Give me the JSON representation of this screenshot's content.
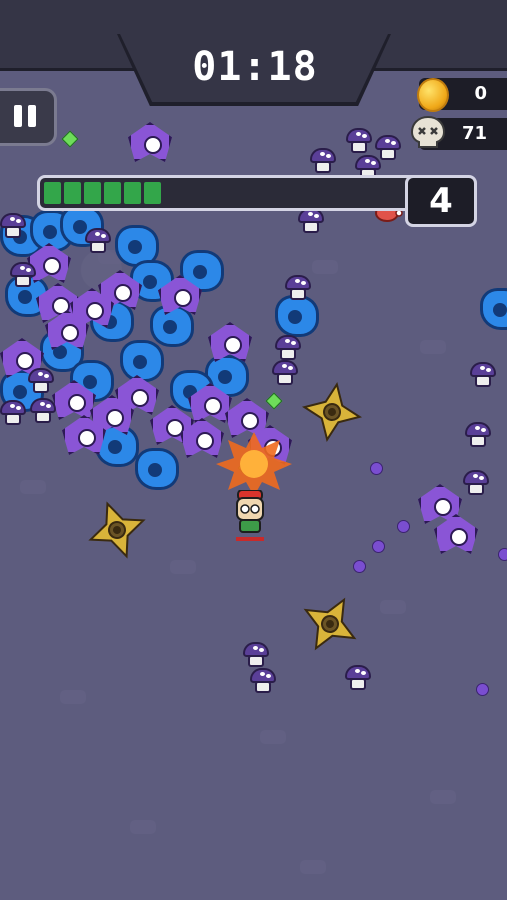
{
  "hud": {
    "timer": "01:18",
    "coins": "0",
    "kills": "71",
    "level": "4",
    "xp_progress": 0.27,
    "xp_segments": 6
  },
  "icons": {
    "pause": "pause-icon",
    "coin": "coin-icon",
    "kills": "skull-icon",
    "pickup": "meat-icon"
  },
  "colors": {
    "background": "#5d5c7e",
    "xp_fill": "#33a64a",
    "enemy_blob": "#2c88e8",
    "enemy_eye": "#8a55d6",
    "enemy_shroom": "#5a3f98",
    "shuriken": "#d9b43a"
  }
}
